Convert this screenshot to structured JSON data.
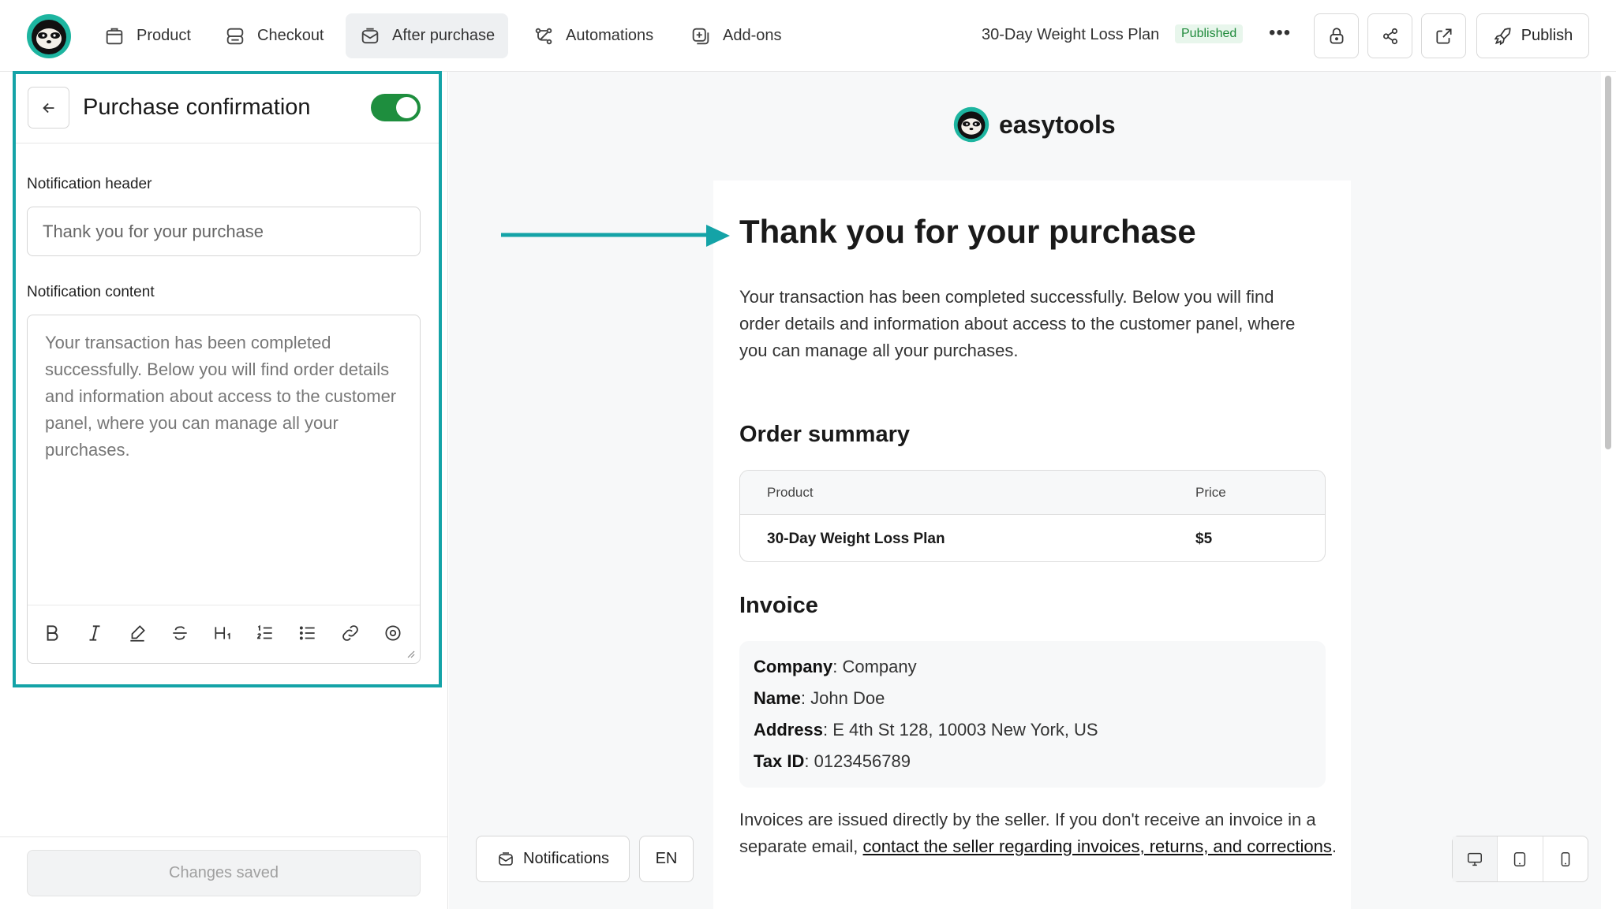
{
  "topbar": {
    "tabs": [
      {
        "label": "Product",
        "icon": "box-icon"
      },
      {
        "label": "Checkout",
        "icon": "checkout-icon"
      },
      {
        "label": "After purchase",
        "icon": "envelope-icon",
        "active": true
      },
      {
        "label": "Automations",
        "icon": "automation-icon"
      },
      {
        "label": "Add-ons",
        "icon": "addon-icon"
      }
    ],
    "plan_title": "30-Day Weight Loss Plan",
    "status": "Published",
    "more": "•••",
    "publish_label": "Publish"
  },
  "left_panel": {
    "title": "Purchase confirmation",
    "toggle_on": true,
    "header_label": "Notification header",
    "header_value": "Thank you for your purchase",
    "content_label": "Notification content",
    "content_value": "Your transaction has been completed successfully. Below you will find order details and information about access to the customer panel, where you can manage all your purchases.",
    "toolbar": [
      "bold-icon",
      "italic-icon",
      "highlight-icon",
      "strikethrough-icon",
      "heading-icon",
      "ordered-list-icon",
      "bullet-list-icon",
      "link-icon",
      "clear-format-icon"
    ],
    "saved_label": "Changes saved"
  },
  "preview": {
    "brand": "easytools",
    "heading": "Thank you for your purchase",
    "intro": "Your transaction has been completed successfully. Below you will find order details and information about access to the customer panel, where you can manage all your purchases.",
    "order_summary_title": "Order summary",
    "table": {
      "headers": [
        "Product",
        "Price"
      ],
      "rows": [
        [
          "30-Day Weight Loss Plan",
          "$5"
        ]
      ]
    },
    "invoice_title": "Invoice",
    "invoice": [
      {
        "label": "Company",
        "value": ": Company"
      },
      {
        "label": "Name",
        "value": ": John Doe"
      },
      {
        "label": "Address",
        "value": ": E 4th St 128, 10003 New York, US"
      },
      {
        "label": "Tax ID",
        "value": ": 0123456789"
      }
    ],
    "footnote_text": "Invoices are issued directly by the seller. If you don't receive an invoice in a separate email, ",
    "footnote_link": "contact the seller regarding invoices, returns, and corrections",
    "footnote_end": "."
  },
  "bottom": {
    "notifications_label": "Notifications",
    "language": "EN",
    "devices": [
      "desktop-icon",
      "tablet-icon",
      "mobile-icon"
    ]
  },
  "colors": {
    "accent": "#14a3a7",
    "toggle": "#1e8e3e",
    "published_bg": "#e8f6ec",
    "published_text": "#1f8a3b"
  }
}
